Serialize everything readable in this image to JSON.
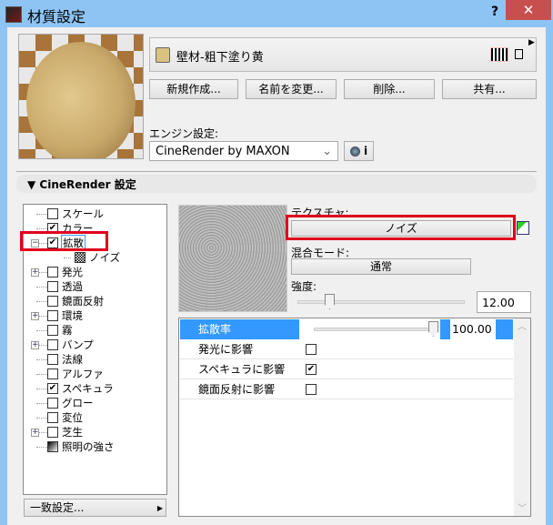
{
  "window": {
    "title": "材質設定",
    "help": "?",
    "close": "✕"
  },
  "material": {
    "name": "壁材-粗下塗り黄",
    "swatch_color": "#d9c27f"
  },
  "buttons": {
    "new": "新規作成...",
    "rename": "名前を変更...",
    "delete": "削除...",
    "share": "共有..."
  },
  "engine": {
    "label": "エンジン設定:",
    "value": "CineRender by MAXON",
    "info": "i"
  },
  "section": {
    "title": "CineRender 設定"
  },
  "tree": [
    {
      "label": "スケール",
      "checked": null,
      "expander": ""
    },
    {
      "label": "カラー",
      "checked": true,
      "expander": ""
    },
    {
      "label": "拡散",
      "checked": true,
      "expander": "−",
      "selected": true
    },
    {
      "label": "ノイズ",
      "checked": null,
      "expander": "",
      "child": true
    },
    {
      "label": "発光",
      "checked": false,
      "expander": "+"
    },
    {
      "label": "透過",
      "checked": false,
      "expander": ""
    },
    {
      "label": "鏡面反射",
      "checked": false,
      "expander": ""
    },
    {
      "label": "環境",
      "checked": false,
      "expander": "+"
    },
    {
      "label": "霧",
      "checked": false,
      "expander": ""
    },
    {
      "label": "バンプ",
      "checked": false,
      "expander": "+"
    },
    {
      "label": "法線",
      "checked": false,
      "expander": ""
    },
    {
      "label": "アルファ",
      "checked": false,
      "expander": ""
    },
    {
      "label": "スペキュラ",
      "checked": true,
      "expander": ""
    },
    {
      "label": "グロー",
      "checked": false,
      "expander": ""
    },
    {
      "label": "変位",
      "checked": false,
      "expander": ""
    },
    {
      "label": "芝生",
      "checked": false,
      "expander": "+"
    },
    {
      "label": "照明の強さ",
      "checked": null,
      "expander": ""
    }
  ],
  "match_button": "一致設定...",
  "texture": {
    "label": "テクスチャ:",
    "value": "ノイズ"
  },
  "blend": {
    "label": "混合モード:",
    "value": "通常"
  },
  "strength": {
    "label": "強度:",
    "value": "12.00",
    "fraction": 0.12
  },
  "props": {
    "diffuse_rate": {
      "label": "拡散率",
      "value": "100.00",
      "fraction": 1.0
    },
    "rows": [
      {
        "label": "発光に影響",
        "checked": false
      },
      {
        "label": "スペキュラに影響",
        "checked": true
      },
      {
        "label": "鏡面反射に影響",
        "checked": false
      }
    ]
  },
  "colors": {
    "selection": "#3399ff",
    "highlight_red": "#e0001b",
    "titlebar": "#8ec4f4"
  }
}
